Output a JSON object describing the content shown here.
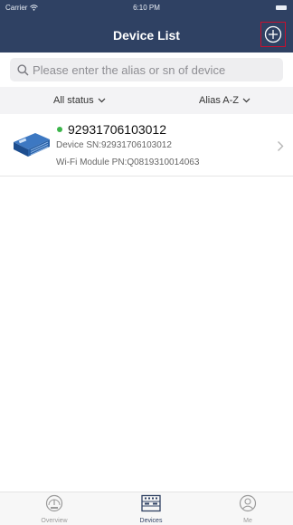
{
  "status_bar": {
    "carrier": "Carrier",
    "time": "6:10 PM"
  },
  "nav": {
    "title": "Device List",
    "add_icon": "plus-circle-icon"
  },
  "search": {
    "placeholder": "Please enter the alias or sn of device",
    "value": ""
  },
  "filters": {
    "status_label": "All status",
    "sort_label": "Alias A-Z"
  },
  "devices": [
    {
      "name": "92931706103012",
      "sn_line": "Device SN:92931706103012",
      "pn_line": "Wi-Fi Module PN:Q0819310014063",
      "status_color": "#3bb54a"
    }
  ],
  "tabs": [
    {
      "label": "Overview",
      "icon": "gauge-icon"
    },
    {
      "label": "Devices",
      "icon": "devices-icon",
      "active": true
    },
    {
      "label": "Me",
      "icon": "user-icon"
    }
  ],
  "colors": {
    "header": "#2f4163",
    "accent_red": "#c8102e",
    "online": "#3bb54a"
  }
}
